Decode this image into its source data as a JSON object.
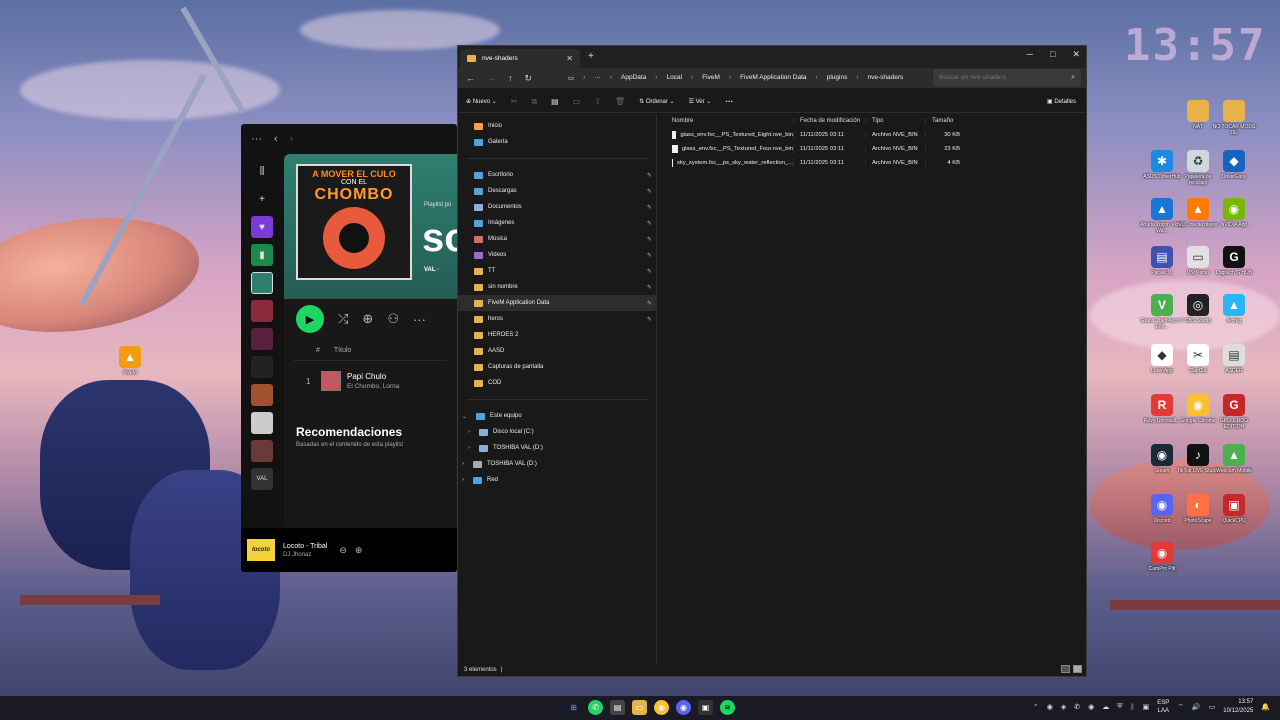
{
  "desktop": {
    "clock_big": "13:57",
    "left_icon": "FiveM",
    "icons": [
      {
        "label": "NAT",
        "color": "#e8b24a",
        "glyph": ""
      },
      {
        "label": "NO TOCAR MODS DE",
        "color": "#e8b24a",
        "glyph": ""
      },
      {
        "label": "ASUS DriverHub",
        "color": "#1e88e5",
        "glyph": "✱"
      },
      {
        "label": "Papelera de reciclaje",
        "color": "#cfd8dc",
        "glyph": "♻"
      },
      {
        "label": "DriverEasy",
        "color": "#1565c0",
        "glyph": "◆"
      },
      {
        "label": "Arturia Tricon Video Wa...",
        "color": "#1976d2",
        "glyph": "▲"
      },
      {
        "label": "VLC media player",
        "color": "#ff7a00",
        "glyph": "▲"
      },
      {
        "label": "NVIDIA App",
        "color": "#76b900",
        "glyph": "◉"
      },
      {
        "label": "ParsecTL",
        "color": "#3f51b5",
        "glyph": "▤"
      },
      {
        "label": "VScPerso",
        "color": "#e0e0e0",
        "glyph": "▭"
      },
      {
        "label": "Logitech G HUB",
        "color": "#111",
        "glyph": "G"
      },
      {
        "label": "Grand Theft Auto V Enh...",
        "color": "#4caf50",
        "glyph": "V"
      },
      {
        "label": "OBS Studio",
        "color": "#222",
        "glyph": "◎"
      },
      {
        "label": "Arcreg",
        "color": "#29b6f6",
        "glyph": "▲"
      },
      {
        "label": "LorenApp",
        "color": "#fff",
        "glyph": "◆"
      },
      {
        "label": "CapCut",
        "color": "#fff",
        "glyph": "✂"
      },
      {
        "label": "ASDER",
        "color": "#ddd",
        "glyph": "▤"
      },
      {
        "label": "Revo Uninstall...",
        "color": "#e53935",
        "glyph": "R"
      },
      {
        "label": "Google Chrome",
        "color": "#fbc02d",
        "glyph": "◉"
      },
      {
        "label": "GPU-Z ROG EDITION",
        "color": "#c62828",
        "glyph": "G"
      },
      {
        "label": "Steam",
        "color": "#1b2838",
        "glyph": "◉"
      },
      {
        "label": "TikTok LIVE Studio",
        "color": "#111",
        "glyph": "♪"
      },
      {
        "label": "Webcam Mobile",
        "color": "#4caf50",
        "glyph": "▲"
      },
      {
        "label": "Discord",
        "color": "#5865f2",
        "glyph": "◉"
      },
      {
        "label": "PhotoScape",
        "color": "#ff7043",
        "glyph": "◐"
      },
      {
        "label": "QuickCPU",
        "color": "#c62828",
        "glyph": "▣"
      },
      {
        "label": "CamPro Pilt",
        "color": "#e53935",
        "glyph": "◉"
      }
    ]
  },
  "spotify": {
    "cover_line1": "A MOVER EL CULO",
    "cover_line2": "CON EL",
    "cover_line3": "CHOMBO",
    "hero_kind": "Playlist pú",
    "hero_title": "so",
    "hero_owner": "VAL ·",
    "col_num": "#",
    "col_title": "Título",
    "tracks": [
      {
        "num": "1",
        "title": "Papi Chulo",
        "artists": "El Chombo, Lorna"
      }
    ],
    "rec_title": "Recomendaciones",
    "rec_subtitle": "Basadas en el contenido de esta playlist",
    "now_thumb": "locoto",
    "now_title": "Locoto - Tribal",
    "now_artist": "DJ Jhonaz"
  },
  "explorer": {
    "tab_title": "nve-shaders",
    "path": [
      "AppData",
      "Local",
      "FiveM",
      "FiveM Application Data",
      "plugins",
      "nve-shaders"
    ],
    "search_placeholder": "Buscar en nve-shaders",
    "toolbar": {
      "new_label": "Nuevo",
      "sort_label": "Ordenar",
      "view_label": "Ver",
      "more_label": "···",
      "details_label": "Detalles"
    },
    "nav_top": [
      "Inicio",
      "Galería"
    ],
    "nav_pinned": [
      "Escritorio",
      "Descargas",
      "Documentos",
      "Imágenes",
      "Música",
      "Videos",
      "TT",
      "sin nombre",
      "FiveM Application Data",
      "heros"
    ],
    "nav_folders": [
      "HEROES 2",
      "AASD",
      "Capturas de pantalla",
      "COD"
    ],
    "nav_pc": "Este equipo",
    "nav_drives": [
      "Disco local (C:)",
      "TOSHIBA VAL (D:)"
    ],
    "nav_extra": [
      "TOSHIBA VAL (D:)",
      "Red"
    ],
    "columns": [
      "Nombre",
      "Fecha de modificación",
      "Tipo",
      "Tamaño"
    ],
    "files": [
      {
        "name": "glass_env.fxc__PS_Textured_Eight.nve_bin",
        "date": "11/11/2025 03:11",
        "type": "Archivo NVE_BIN",
        "size": "30 KB"
      },
      {
        "name": "glass_env.fxc__PS_Textured_Four.nve_bin",
        "date": "11/11/2025 03:11",
        "type": "Archivo NVE_BIN",
        "size": "23 KB"
      },
      {
        "name": "sky_system.fxc__ps_sky_water_reflection_...",
        "date": "11/11/2025 03:11",
        "type": "Archivo NVE_BIN",
        "size": "4 KB"
      }
    ],
    "status": "3 elementos"
  },
  "taskbar": {
    "lang_top": "ESP",
    "lang_bottom": "LAA",
    "time": "13:57",
    "date": "10/12/2025"
  }
}
